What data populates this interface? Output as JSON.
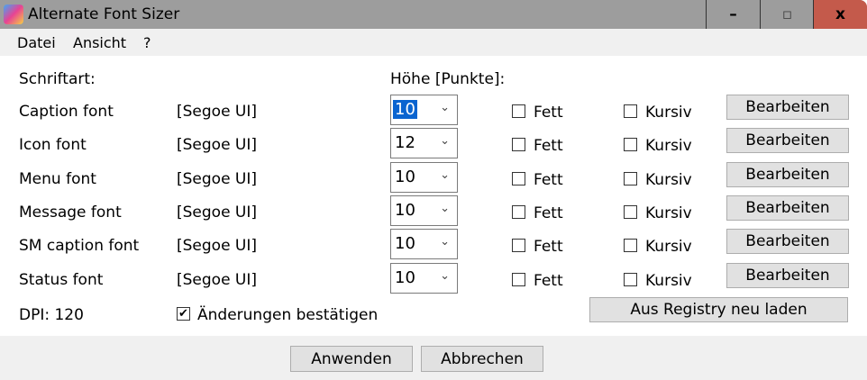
{
  "window": {
    "title": "Alternate Font Sizer",
    "minimize": "–",
    "maximize": "▫",
    "close": "x"
  },
  "menu": [
    "Datei",
    "Ansicht",
    "?"
  ],
  "headers": {
    "font": "Schriftart:",
    "height": "Höhe [Punkte]:"
  },
  "rows": [
    {
      "name": "Caption font",
      "face": "[Segoe UI]",
      "size": "10",
      "bold": "Fett",
      "italic": "Kursiv",
      "edit": "Bearbeiten"
    },
    {
      "name": "Icon font",
      "face": "[Segoe UI]",
      "size": "12",
      "bold": "Fett",
      "italic": "Kursiv",
      "edit": "Bearbeiten"
    },
    {
      "name": "Menu font",
      "face": "[Segoe UI]",
      "size": "10",
      "bold": "Fett",
      "italic": "Kursiv",
      "edit": "Bearbeiten"
    },
    {
      "name": "Message font",
      "face": "[Segoe UI]",
      "size": "10",
      "bold": "Fett",
      "italic": "Kursiv",
      "edit": "Bearbeiten"
    },
    {
      "name": "SM caption font",
      "face": "[Segoe UI]",
      "size": "10",
      "bold": "Fett",
      "italic": "Kursiv",
      "edit": "Bearbeiten"
    },
    {
      "name": "Status font",
      "face": "[Segoe UI]",
      "size": "10",
      "bold": "Fett",
      "italic": "Kursiv",
      "edit": "Bearbeiten"
    }
  ],
  "dpi": "DPI: 120",
  "confirm": {
    "label": "Änderungen bestätigen",
    "checked": true
  },
  "reload": "Aus Registry neu laden",
  "apply": "Anwenden",
  "cancel": "Abbrechen"
}
